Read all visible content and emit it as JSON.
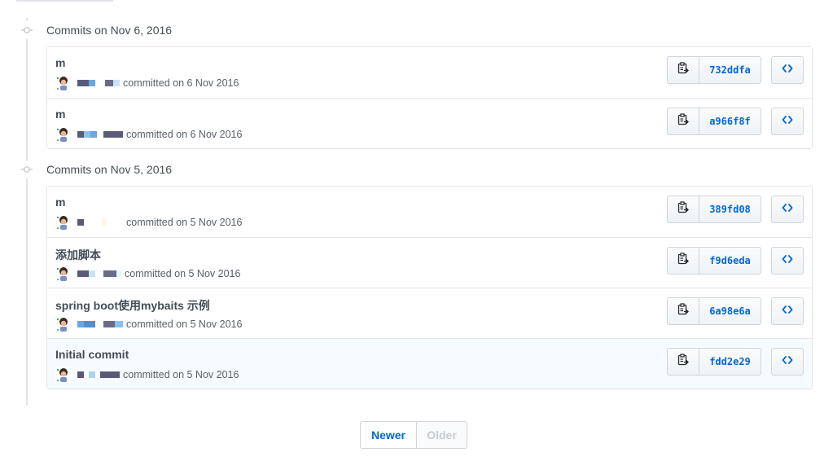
{
  "groups": [
    {
      "title": "Commits on Nov 6, 2016",
      "commits": [
        {
          "message": "m",
          "committed": "committed on 6 Nov 2016",
          "sha": "732ddfa",
          "highlight": false,
          "pix": [
            [
              "#5a5a78",
              14
            ],
            [
              "#6aa6e0",
              8
            ],
            [
              "#ffffff",
              12
            ],
            [
              "#6a6a8a",
              10
            ],
            [
              "#c9e3f7",
              8
            ]
          ]
        },
        {
          "message": "m",
          "committed": "committed on 6 Nov 2016",
          "sha": "a966f8f",
          "highlight": false,
          "pix": [
            [
              "#5a5a78",
              8
            ],
            [
              "#8ac0ea",
              8
            ],
            [
              "#6aa6e0",
              8
            ],
            [
              "#ffffff",
              8
            ],
            [
              "#5a5a78",
              24
            ]
          ]
        }
      ]
    },
    {
      "title": "Commits on Nov 5, 2016",
      "commits": [
        {
          "message": "m",
          "committed": "committed on 5 Nov 2016",
          "sha": "389fd08",
          "highlight": false,
          "pix": [
            [
              "#5a5a78",
              8
            ],
            [
              "#ffffff",
              22
            ],
            [
              "#fbf7dc",
              6
            ],
            [
              "#ffffff",
              20
            ]
          ]
        },
        {
          "message": "添加脚本",
          "committed": "committed on 5 Nov 2016",
          "sha": "f9d6eda",
          "highlight": false,
          "pix": [
            [
              "#5a5a78",
              14
            ],
            [
              "#c9e3f7",
              8
            ],
            [
              "#ffffff",
              10
            ],
            [
              "#6a6a8a",
              16
            ],
            [
              "#e6f4fb",
              6
            ]
          ]
        },
        {
          "message": "spring boot使用mybaits 示例",
          "committed": "committed on 5 Nov 2016",
          "sha": "6a98e6a",
          "highlight": false,
          "pix": [
            [
              "#6aa6e0",
              8
            ],
            [
              "#5a8ccc",
              14
            ],
            [
              "#ffffff",
              10
            ],
            [
              "#6a6a8a",
              14
            ],
            [
              "#8ac0ea",
              10
            ]
          ]
        },
        {
          "message": "Initial commit",
          "committed": "committed on 5 Nov 2016",
          "sha": "fdd2e29",
          "highlight": true,
          "pix": [
            [
              "#5a5a78",
              8
            ],
            [
              "#ffffff",
              6
            ],
            [
              "#a9d4f5",
              8
            ],
            [
              "#ffffff",
              6
            ],
            [
              "#5a5a78",
              24
            ]
          ]
        }
      ]
    }
  ],
  "pagination": {
    "newer": "Newer",
    "older": "Older"
  },
  "icons": {
    "clipboard": "clipboard-icon",
    "browse": "code-icon",
    "commit": "git-commit-icon"
  }
}
